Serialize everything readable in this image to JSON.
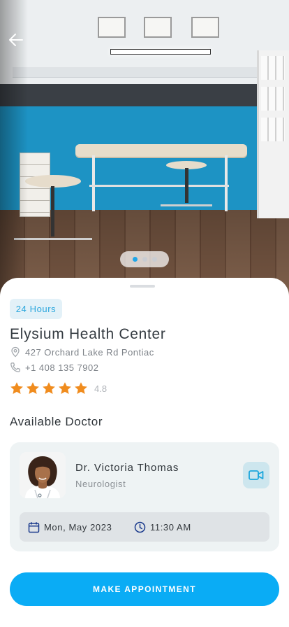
{
  "hero": {
    "back_icon": "arrow-left-icon",
    "carousel": {
      "count": 3,
      "active": 1
    }
  },
  "clinic": {
    "hours_badge": "24 Hours",
    "name": "Elysium Health Center",
    "address": "427 Orchard Lake Rd Pontiac",
    "phone": "+1 408 135 7902",
    "rating": {
      "stars": 5,
      "value": "4.8"
    }
  },
  "doctors": {
    "section_title": "Available Doctor",
    "items": [
      {
        "name": "Dr. Victoria Thomas",
        "specialty": "Neurologist",
        "date": "Mon, May 2023",
        "time": "11:30 AM"
      }
    ]
  },
  "cta": {
    "label": "MAKE APPOINTMENT"
  },
  "colors": {
    "accent": "#0aacf5",
    "star": "#f08c1e",
    "badge_bg": "#e3f1f8",
    "card_bg": "#eef3f4",
    "icon_blue": "#1a3a8c"
  }
}
